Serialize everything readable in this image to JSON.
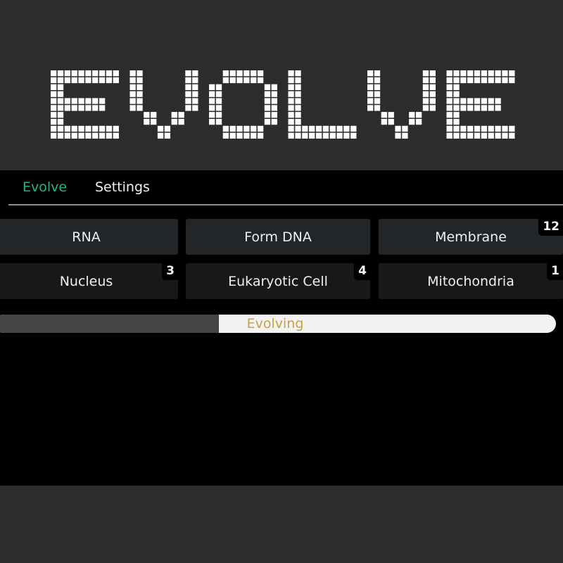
{
  "logo": {
    "text": "EVOLVE"
  },
  "tabs": [
    {
      "label": "Evolve",
      "active": true
    },
    {
      "label": "Settings",
      "active": false
    }
  ],
  "actions": [
    {
      "label": "RNA",
      "count": null
    },
    {
      "label": "Form DNA",
      "count": null
    },
    {
      "label": "Membrane",
      "count": "12"
    },
    {
      "label": "Nucleus",
      "count": "3"
    },
    {
      "label": "Eukaryotic Cell",
      "count": "4"
    },
    {
      "label": "Mitochondria",
      "count": "1"
    }
  ],
  "progress": {
    "label": "Evolving",
    "fraction": 0.4
  },
  "colors": {
    "accent": "#26b48e",
    "progress_text": "#c4a14a",
    "background": "#2b2c2b",
    "panel": "#000000"
  }
}
